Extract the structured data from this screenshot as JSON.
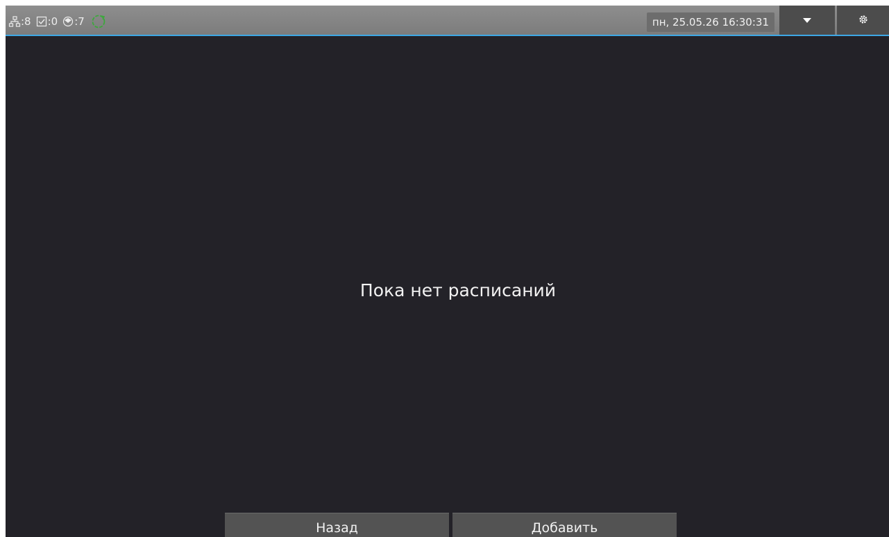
{
  "status_bar": {
    "network_count": ":8",
    "tasks_count": ":0",
    "alerts_count": ":7",
    "sync_color": "#3ca83c"
  },
  "datetime": "пн, 25.05.26 16:30:31",
  "header_buttons": {
    "menu_icon": "chevron-down-icon",
    "settings_icon": "gear-icon"
  },
  "main": {
    "empty_message": "Пока нет расписаний"
  },
  "footer": {
    "back_label": "Назад",
    "add_label": "Добавить"
  },
  "colors": {
    "background": "#232228",
    "accent": "#3ea8e6",
    "button": "#535353"
  }
}
